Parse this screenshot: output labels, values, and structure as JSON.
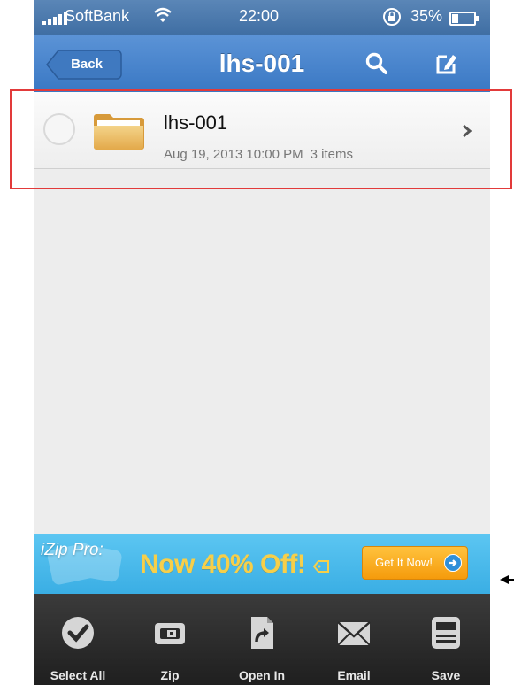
{
  "status_bar": {
    "carrier": "SoftBank",
    "time": "22:00",
    "battery_percent": "35%",
    "battery_level": 0.35,
    "icons": [
      "signal-icon",
      "wifi-icon",
      "rotation-lock-icon",
      "battery-icon"
    ]
  },
  "nav": {
    "back_label": "Back",
    "title": "lhs-001",
    "icons": [
      "search-icon",
      "compose-icon"
    ]
  },
  "files": [
    {
      "name": "lhs-001",
      "date": "Aug 19, 2013 10:00 PM",
      "items": "3 items",
      "icon": "folder-icon"
    }
  ],
  "banner": {
    "brand": "iZip Pro:",
    "promo": "Now 40% Off!",
    "cta": "Get It Now!",
    "icons": [
      "tag-icon",
      "arrow-right-circle-icon"
    ]
  },
  "toolbar": [
    {
      "label": "Select All",
      "icon": "checkmark-circle-icon"
    },
    {
      "label": "Zip",
      "icon": "zip-icon"
    },
    {
      "label": "Open In",
      "icon": "open-in-icon"
    },
    {
      "label": "Email",
      "icon": "envelope-icon"
    },
    {
      "label": "Save",
      "icon": "save-icon"
    }
  ],
  "colors": {
    "navbar": "#3a78c4",
    "banner": "#3aaee4",
    "promo_text": "#f6cf4a",
    "cta": "#f59b0c",
    "toolbar": "#2a2a2a",
    "highlight": "#e23a3a"
  }
}
